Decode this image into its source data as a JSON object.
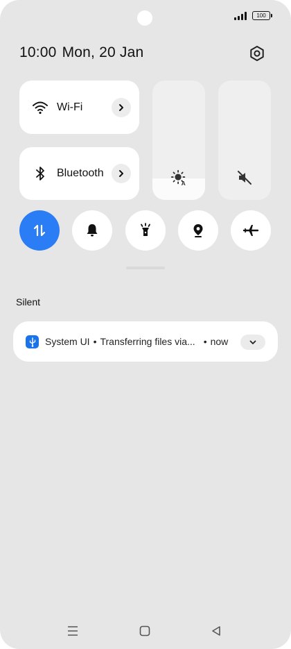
{
  "status": {
    "battery": "100"
  },
  "header": {
    "time": "10:00",
    "date": "Mon, 20 Jan"
  },
  "tiles": {
    "wifi": {
      "label": "Wi-Fi",
      "icon": "wifi-icon"
    },
    "bluetooth": {
      "label": "Bluetooth",
      "icon": "bluetooth-icon"
    }
  },
  "sliders": {
    "brightness": {
      "icon": "auto-brightness-icon",
      "level": 0.18
    },
    "volume": {
      "icon": "volume-muted-icon",
      "level": 0.0
    }
  },
  "quick_toggles": [
    {
      "name": "mobile-data",
      "icon": "data-arrows-icon",
      "active": true
    },
    {
      "name": "sound",
      "icon": "bell-icon",
      "active": false
    },
    {
      "name": "flashlight",
      "icon": "flashlight-icon",
      "active": false
    },
    {
      "name": "location",
      "icon": "location-pin-icon",
      "active": false
    },
    {
      "name": "airplane-mode",
      "icon": "airplane-icon",
      "active": false
    }
  ],
  "notifications": {
    "section_title": "Silent",
    "items": [
      {
        "app": "System UI",
        "text": "Transferring files via...",
        "time": "now",
        "icon": "usb-icon"
      }
    ]
  },
  "colors": {
    "accent": "#2a7df4",
    "background": "#e6e6e6",
    "tile": "#ffffff"
  }
}
